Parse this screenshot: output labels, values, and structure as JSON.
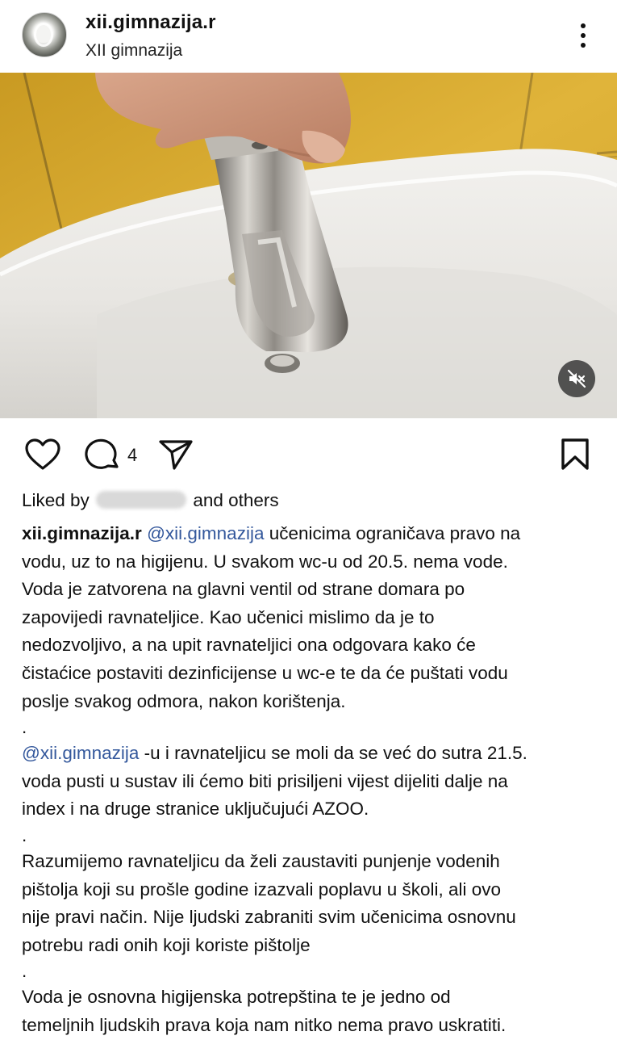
{
  "header": {
    "username": "xii.gimnazija.r",
    "subtitle": "XII gimnazija"
  },
  "actions": {
    "comment_count": "4"
  },
  "likes": {
    "prefix": "Liked by",
    "suffix": "and others"
  },
  "caption": {
    "handle": "xii.gimnazija.r",
    "mention1": "@xii.gimnazija",
    "line1_rest": " učenicima ograničava pravo na",
    "line2": "vodu, uz to na higijenu. U svakom wc-u od 20.5. nema vode.",
    "line3": "Voda je zatvorena na glavni ventil od strane domara po",
    "line4": "zapovijedi ravnateljice. Kao učenici mislimo da je to",
    "line5": "nedozvoljivo, a na upit ravnateljici ona odgovara kako će",
    "line6": "čistaćice postaviti dezinficijense u wc-e te da će puštati vodu",
    "line7": "poslje svakog odmora, nakon korištenja.",
    "separator": ".",
    "mention2": "@xii.gimnazija",
    "line8_rest": " -u i ravnateljicu se moli da se već do sutra 21.5.",
    "line9": "voda pusti u sustav ili ćemo biti prisiljeni vijest dijeliti dalje na",
    "line10": "index i na druge stranice uključujući AZOO.",
    "line11": "Razumijemo ravnateljicu da želi zaustaviti punjenje vodenih",
    "line12": "pištolja koji su prošle godine izazvali poplavu u školi, ali ovo",
    "line13": "nije pravi način. Nije ljudski zabraniti svim učenicima osnovnu",
    "line14": "potrebu radi onih koji koriste pištolje",
    "line15": "Voda je osnovna higijenska potrepština te je jedno od",
    "line16": "temeljnih ljudskih prava koja nam nitko nema pravo uskratiti."
  },
  "icons": {
    "more": "more-vertical-icon",
    "like": "heart-icon",
    "comment": "comment-icon",
    "share": "send-icon",
    "save": "bookmark-icon",
    "mute": "speaker-muted-icon"
  },
  "colors": {
    "mention": "#34589c",
    "text": "#111111",
    "background": "#ffffff"
  }
}
